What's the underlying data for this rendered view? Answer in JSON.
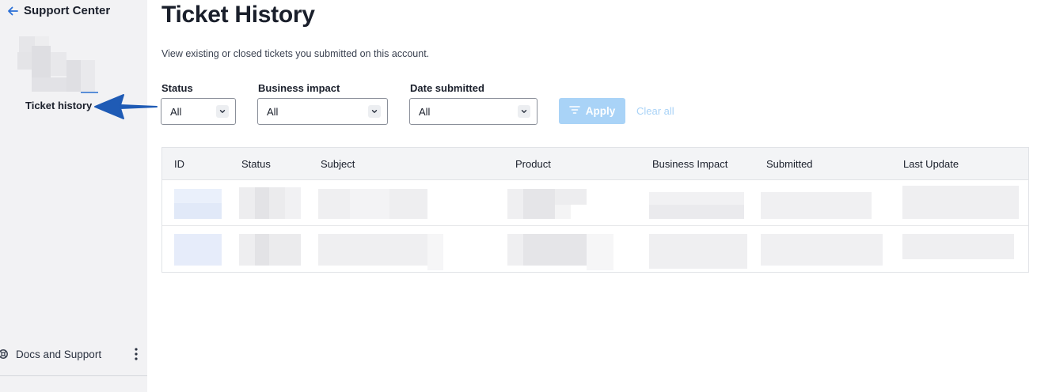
{
  "sidebar": {
    "back_label": "Support Center",
    "item_ticket_history": "Ticket history",
    "footer_label": "Docs and Support"
  },
  "page": {
    "title": "Ticket History",
    "description": "View existing or closed tickets you submitted on this account."
  },
  "filters": {
    "status": {
      "label": "Status",
      "value": "All"
    },
    "business_impact": {
      "label": "Business impact",
      "value": "All"
    },
    "date_submitted": {
      "label": "Date submitted",
      "value": "All"
    },
    "apply_label": "Apply",
    "clear_label": "Clear all"
  },
  "table": {
    "columns": [
      "ID",
      "Status",
      "Subject",
      "Product",
      "Business Impact",
      "Submitted",
      "Last Update"
    ]
  },
  "colors": {
    "accent_disabled": "#a9d3f7",
    "annotation_arrow": "#1f5bb5",
    "sidebar_bg": "#f2f2f4"
  },
  "icons": {
    "back": "arrow-left-icon",
    "footer": "lifebuoy-icon",
    "more": "kebab-icon",
    "filter": "filter-lines-icon",
    "dropdown": "chevron-down-icon"
  }
}
